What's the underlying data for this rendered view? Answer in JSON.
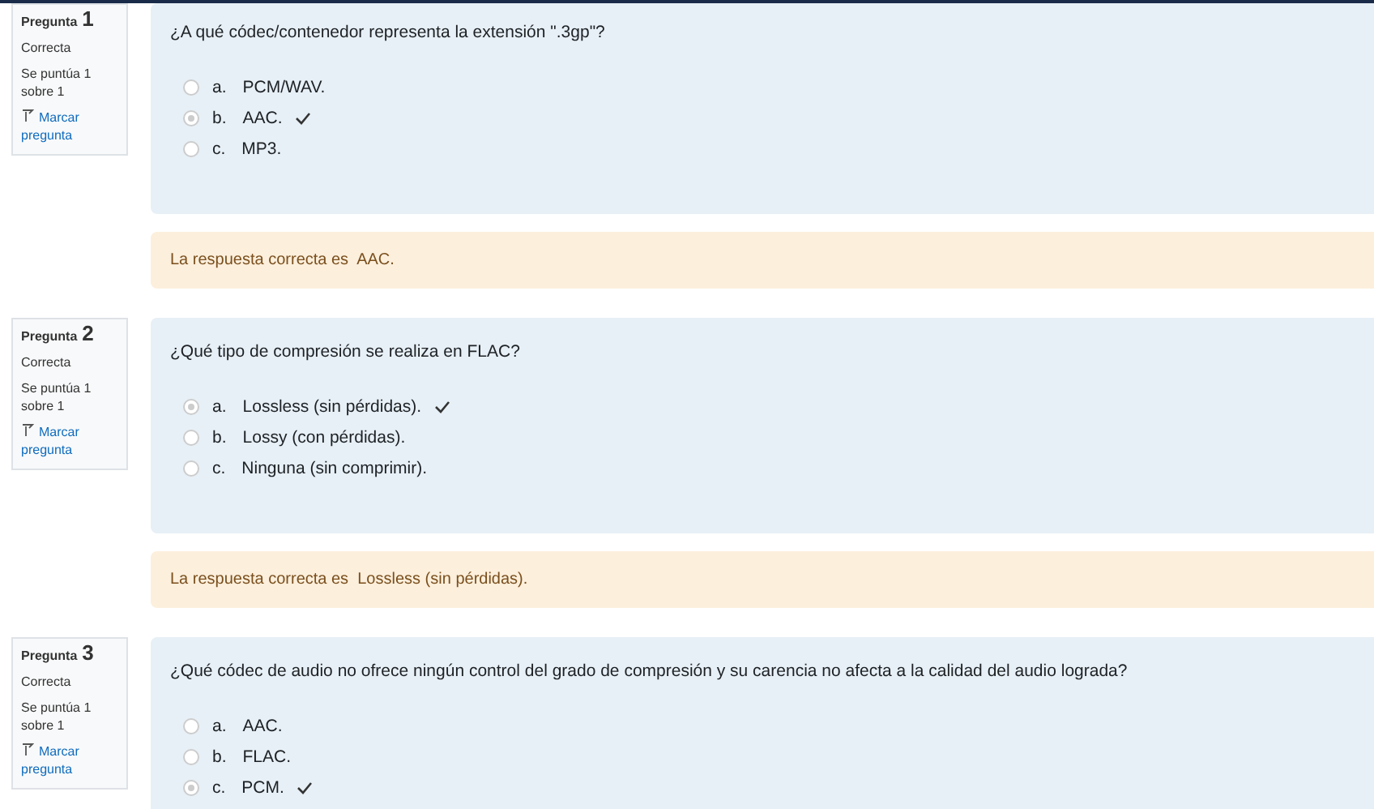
{
  "questions": [
    {
      "label": "Pregunta",
      "number": "1",
      "status": "Correcta",
      "score": "Se puntúa 1 sobre 1",
      "flag": "Marcar pregunta",
      "text": "¿A qué códec/contenedor representa la extensión \".3gp\"?",
      "options": [
        {
          "letter": "a.",
          "text": "PCM/WAV.",
          "selected": false,
          "correct": false
        },
        {
          "letter": "b.",
          "text": "AAC.",
          "selected": true,
          "correct": true
        },
        {
          "letter": "c.",
          "text": "MP3.",
          "selected": false,
          "correct": false
        }
      ],
      "feedback": "La respuesta correcta es  AAC."
    },
    {
      "label": "Pregunta",
      "number": "2",
      "status": "Correcta",
      "score": "Se puntúa 1 sobre 1",
      "flag": "Marcar pregunta",
      "text": "¿Qué tipo de compresión se realiza en FLAC?",
      "options": [
        {
          "letter": "a.",
          "text": "Lossless (sin pérdidas).",
          "selected": true,
          "correct": true
        },
        {
          "letter": "b.",
          "text": "Lossy (con pérdidas).",
          "selected": false,
          "correct": false
        },
        {
          "letter": "c.",
          "text": "Ninguna (sin comprimir).",
          "selected": false,
          "correct": false
        }
      ],
      "feedback": "La respuesta correcta es  Lossless (sin pérdidas)."
    },
    {
      "label": "Pregunta",
      "number": "3",
      "status": "Correcta",
      "score": "Se puntúa 1 sobre 1",
      "flag": "Marcar pregunta",
      "text": "¿Qué códec de audio no ofrece ningún control del grado de compresión y su carencia no afecta a la calidad del audio lograda?",
      "options": [
        {
          "letter": "a.",
          "text": "AAC.",
          "selected": false,
          "correct": false
        },
        {
          "letter": "b.",
          "text": "FLAC.",
          "selected": false,
          "correct": false
        },
        {
          "letter": "c.",
          "text": "PCM.",
          "selected": true,
          "correct": true
        }
      ]
    }
  ]
}
